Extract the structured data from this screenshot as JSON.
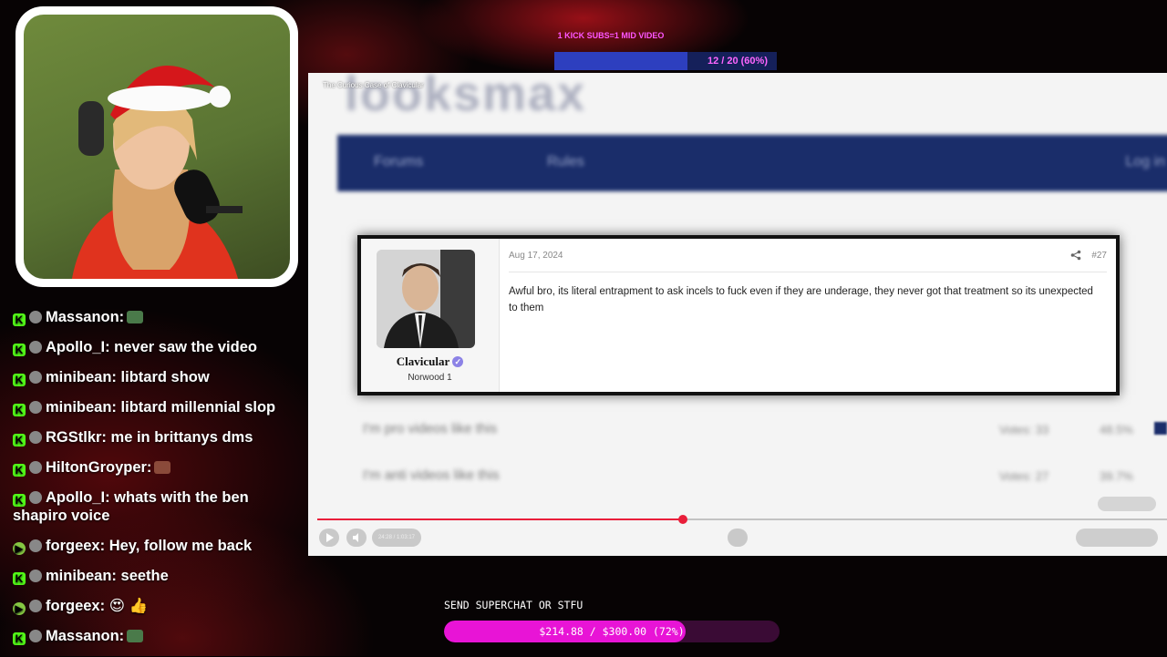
{
  "overlay": {
    "subgoal_title": "1 KICK SUBS=1 MID VIDEO",
    "subgoal_text": "12 / 20 (60%)",
    "subgoal_progress": 0.6,
    "donation_label": "SEND SUPERCHAT OR STFU",
    "donation_text": "$214.88 / $300.00 (72%)",
    "donation_progress": 0.72
  },
  "chat": [
    {
      "platform": "kick",
      "user": "Massanon:",
      "text": "",
      "emote": true
    },
    {
      "platform": "kick",
      "user": "Apollo_I:",
      "text": " never saw the video",
      "emote": false
    },
    {
      "platform": "kick",
      "user": "minibean:",
      "text": " libtard show",
      "emote": false
    },
    {
      "platform": "kick",
      "user": "minibean:",
      "text": " libtard millennial slop",
      "emote": false
    },
    {
      "platform": "kick",
      "user": "RGStlkr:",
      "text": " me in brittanys dms",
      "emote": false
    },
    {
      "platform": "kick",
      "user": "HiltonGroyper:",
      "text": "",
      "emote": true
    },
    {
      "platform": "kick",
      "user": "Apollo_I:",
      "text": " whats with the ben shapiro voice",
      "emote": false
    },
    {
      "platform": "rumble",
      "user": "forgeex:",
      "text": " Hey, follow me back",
      "emote": false
    },
    {
      "platform": "kick",
      "user": "minibean:",
      "text": " seethe",
      "emote": false
    },
    {
      "platform": "rumble",
      "user": "forgeex:",
      "text": " 😍 👍",
      "emote": false
    },
    {
      "platform": "kick",
      "user": "Massanon:",
      "text": "",
      "emote": true
    }
  ],
  "video": {
    "title": "The Curious Case of Clavicular",
    "site_logo": "looksmax",
    "nav_forums": "Forums",
    "nav_rules": "Rules",
    "nav_login": "Log in",
    "poll_row_1": "I'm pro videos like this",
    "poll_row_1_votes": "Votes: 33",
    "poll_row_1_pct": "48.5%",
    "poll_row_2": "I'm anti videos like this",
    "poll_row_2_votes": "Votes: 27",
    "poll_row_2_pct": "39.7%",
    "time": "24:28 / 1:03:17",
    "progress": 0.43
  },
  "post": {
    "username": "Clavicular",
    "user_title": "Norwood 1",
    "date": "Aug 17, 2024",
    "number": "#27",
    "body": "Awful bro, its literal entrapment to ask incels to fuck even if they are underage, they never got that treatment so its unexpected to them"
  },
  "colors": {
    "kick": "#53fc18",
    "rumble": "#85c742",
    "donation_fill": "#e814d6",
    "progress": "#e91e3a",
    "nav": "#1a2d6a"
  }
}
